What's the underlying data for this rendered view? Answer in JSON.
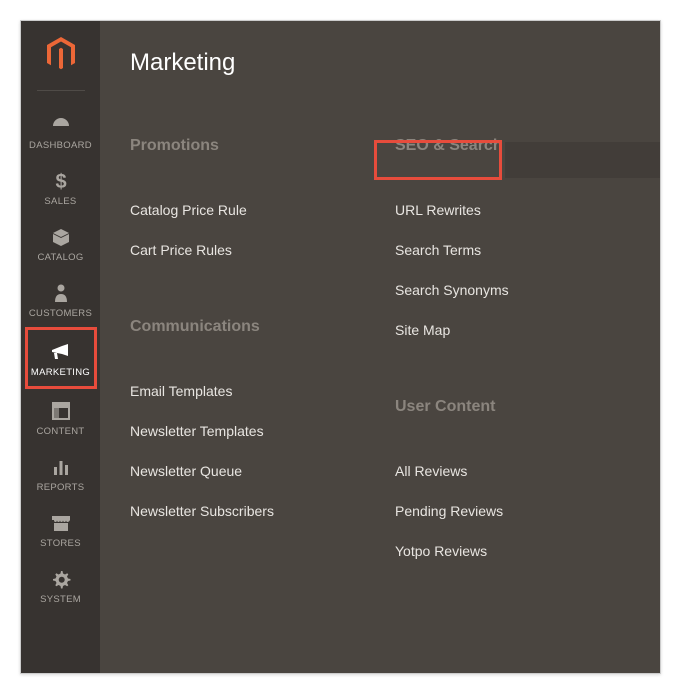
{
  "sidebar": {
    "items": [
      {
        "label": "DASHBOARD"
      },
      {
        "label": "SALES"
      },
      {
        "label": "CATALOG"
      },
      {
        "label": "CUSTOMERS"
      },
      {
        "label": "MARKETING"
      },
      {
        "label": "CONTENT"
      },
      {
        "label": "REPORTS"
      },
      {
        "label": "STORES"
      },
      {
        "label": "SYSTEM"
      }
    ]
  },
  "panel": {
    "title": "Marketing",
    "left": {
      "promotions_title": "Promotions",
      "promotions_items": [
        "Catalog Price Rule",
        "Cart Price Rules"
      ],
      "communications_title": "Communications",
      "communications_items": [
        "Email Templates",
        "Newsletter Templates",
        "Newsletter Queue",
        "Newsletter Subscribers"
      ]
    },
    "right": {
      "seo_title": "SEO & Search",
      "seo_items": [
        "URL Rewrites",
        "Search Terms",
        "Search Synonyms",
        "Site Map"
      ],
      "user_title": "User Content",
      "user_items": [
        "All Reviews",
        "Pending Reviews",
        "Yotpo Reviews"
      ]
    }
  }
}
